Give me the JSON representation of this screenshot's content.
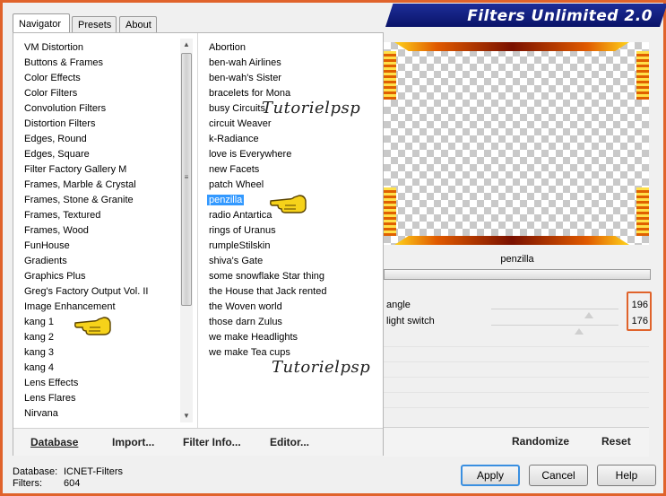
{
  "tabs": [
    {
      "label": "Navigator",
      "active": true
    },
    {
      "label": "Presets",
      "active": false
    },
    {
      "label": "About",
      "active": false
    }
  ],
  "app_title": "Filters Unlimited 2.0",
  "categories": [
    "VM Distortion",
    "Buttons & Frames",
    "Color Effects",
    "Color Filters",
    "Convolution Filters",
    "Distortion Filters",
    "Edges, Round",
    "Edges, Square",
    "Filter Factory Gallery M",
    "Frames, Marble & Crystal",
    "Frames, Stone & Granite",
    "Frames, Textured",
    "Frames, Wood",
    "FunHouse",
    "Gradients",
    "Graphics Plus",
    "Greg's Factory Output Vol. II",
    "Image Enhancement",
    "kang 1",
    "kang 2",
    "kang 3",
    "kang 4",
    "Lens Effects",
    "Lens Flares",
    "Nirvana"
  ],
  "filters": [
    "Abortion",
    "ben-wah Airlines",
    "ben-wah's Sister",
    "bracelets for Mona",
    "busy Circuits",
    "circuit Weaver",
    "k-Radiance",
    "love is Everywhere",
    "new Facets",
    "patch Wheel",
    "penzilla",
    "radio Antartica",
    "rings of Uranus",
    "rumpleStilskin",
    "shiva's Gate",
    "some snowflake Star thing",
    "the House that Jack rented",
    "the Woven world",
    "those darn Zulus",
    "we make Headlights",
    "we make Tea cups"
  ],
  "selected_filter": "penzilla",
  "bottom_links": {
    "database": "Database",
    "import": "Import...",
    "filter_info": "Filter Info...",
    "editor": "Editor..."
  },
  "preview": {
    "name": "penzilla"
  },
  "params": [
    {
      "label": "angle",
      "value": "196",
      "level": 0.77
    },
    {
      "label": "light switch",
      "value": "176",
      "level": 0.69
    }
  ],
  "right_buttons": {
    "randomize": "Randomize",
    "reset": "Reset"
  },
  "status": {
    "database_label": "Database:",
    "database_value": "ICNET-Filters",
    "filters_label": "Filters:",
    "filters_value": "604"
  },
  "dialog_buttons": {
    "apply": "Apply",
    "cancel": "Cancel",
    "help": "Help"
  },
  "watermark": "Tutorielpsp",
  "colors": {
    "accent": "#e0632b",
    "banner": "#1d2d99",
    "selection": "#3399ff"
  }
}
